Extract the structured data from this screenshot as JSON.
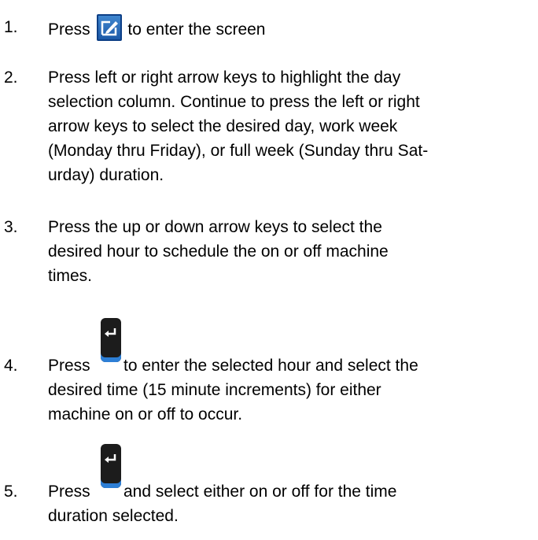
{
  "steps": [
    {
      "number": "1.",
      "text_before": "Press",
      "icon": "edit-icon",
      "text_after": "to enter the screen"
    },
    {
      "number": "2.",
      "lines": [
        "Press left or right arrow keys to highlight the day",
        "selection column. Continue to press the left or right",
        "arrow keys to select the desired day, work week",
        "(Monday thru Friday), or full week (Sunday thru Sat-",
        "urday) duration."
      ]
    },
    {
      "number": "3.",
      "lines": [
        "Press the up or down arrow keys to select the",
        "desired hour to schedule the on or off machine",
        "times."
      ]
    },
    {
      "number": "4.",
      "text_before": "Press",
      "icon": "enter-icon",
      "text_after": "to enter the selected hour and select the",
      "lines": [
        "desired time (15 minute increments) for either",
        "machine on or off to occur."
      ]
    },
    {
      "number": "5.",
      "text_before": "Press",
      "icon": "enter-icon",
      "text_after": "and select either on or off for the time",
      "lines": [
        "duration selected."
      ]
    }
  ],
  "colors": {
    "text": "#000000",
    "edit_icon_blue": "#1d5aa8",
    "enter_icon_dark": "#1c1c1c",
    "enter_icon_accent": "#2d7fd6"
  }
}
